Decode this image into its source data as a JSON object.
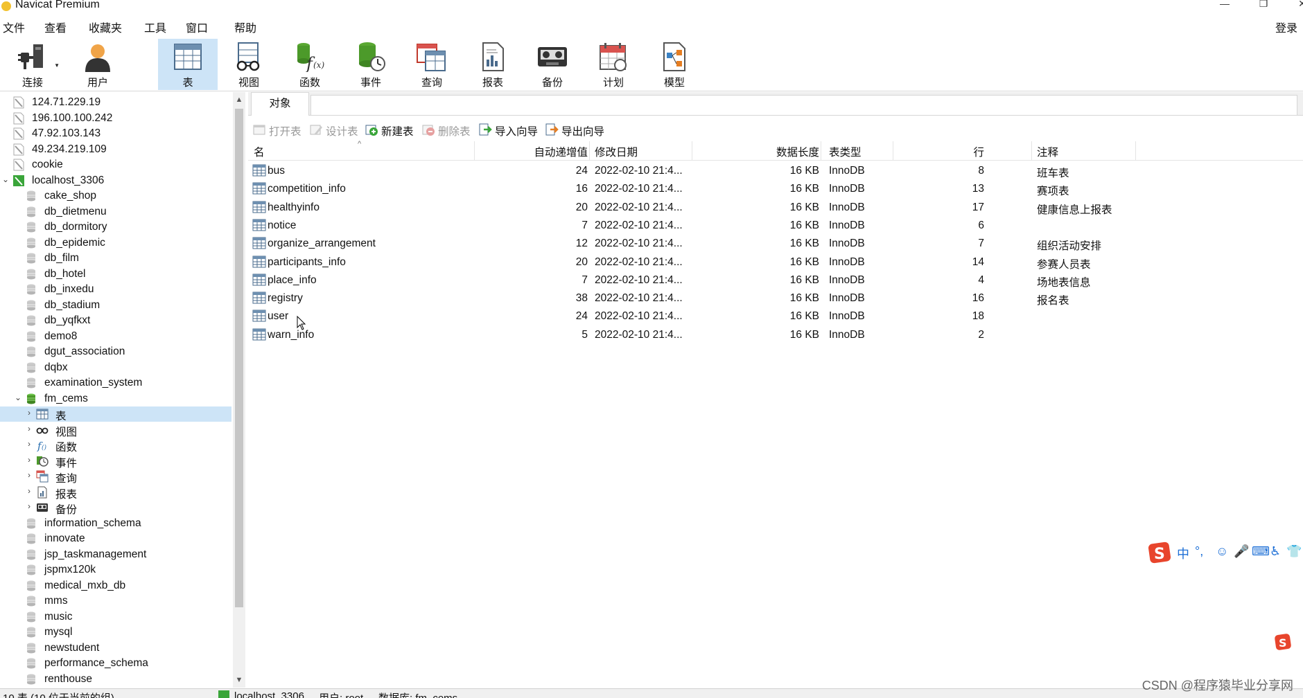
{
  "window": {
    "title": "Navicat Premium",
    "minimize": "—",
    "restore": "❐",
    "close": "✕"
  },
  "menu": [
    "文件",
    "查看",
    "收藏夹",
    "工具",
    "窗口",
    "帮助"
  ],
  "login_label": "登录",
  "toolbar": [
    {
      "label": "连接",
      "icon": "connection-plug-icon"
    },
    {
      "label": "用户",
      "icon": "user-icon"
    },
    {
      "label": "表",
      "icon": "table-icon",
      "active": true
    },
    {
      "label": "视图",
      "icon": "view-glasses-icon"
    },
    {
      "label": "函数",
      "icon": "function-icon"
    },
    {
      "label": "事件",
      "icon": "event-clock-icon"
    },
    {
      "label": "查询",
      "icon": "query-icon"
    },
    {
      "label": "报表",
      "icon": "report-icon"
    },
    {
      "label": "备份",
      "icon": "backup-icon"
    },
    {
      "label": "计划",
      "icon": "schedule-calendar-icon"
    },
    {
      "label": "模型",
      "icon": "model-icon"
    }
  ],
  "tree": [
    {
      "label": "124.71.229.19",
      "type": "server"
    },
    {
      "label": "196.100.100.242",
      "type": "server"
    },
    {
      "label": "47.92.103.143",
      "type": "server"
    },
    {
      "label": "49.234.219.109",
      "type": "server"
    },
    {
      "label": "cookie",
      "type": "server"
    },
    {
      "label": "localhost_3306",
      "type": "server-open",
      "expander": "⌄"
    },
    {
      "label": "cake_shop",
      "type": "db"
    },
    {
      "label": "db_dietmenu",
      "type": "db"
    },
    {
      "label": "db_dormitory",
      "type": "db"
    },
    {
      "label": "db_epidemic",
      "type": "db"
    },
    {
      "label": "db_film",
      "type": "db"
    },
    {
      "label": "db_hotel",
      "type": "db"
    },
    {
      "label": "db_inxedu",
      "type": "db"
    },
    {
      "label": "db_stadium",
      "type": "db"
    },
    {
      "label": "db_yqfkxt",
      "type": "db"
    },
    {
      "label": "demo8",
      "type": "db"
    },
    {
      "label": "dgut_association",
      "type": "db"
    },
    {
      "label": "dqbx",
      "type": "db"
    },
    {
      "label": "examination_system",
      "type": "db"
    },
    {
      "label": "fm_cems",
      "type": "db-open",
      "expander": "⌄"
    },
    {
      "label": "表",
      "type": "node-table",
      "expander": "›",
      "selected": true
    },
    {
      "label": "视图",
      "type": "node-view",
      "expander": "›"
    },
    {
      "label": "函数",
      "type": "node-func",
      "expander": "›"
    },
    {
      "label": "事件",
      "type": "node-event",
      "expander": "›"
    },
    {
      "label": "查询",
      "type": "node-query",
      "expander": "›"
    },
    {
      "label": "报表",
      "type": "node-report",
      "expander": "›"
    },
    {
      "label": "备份",
      "type": "node-backup",
      "expander": "›"
    },
    {
      "label": "information_schema",
      "type": "db"
    },
    {
      "label": "innovate",
      "type": "db"
    },
    {
      "label": "jsp_taskmanagement",
      "type": "db"
    },
    {
      "label": "jspmx120k",
      "type": "db"
    },
    {
      "label": "medical_mxb_db",
      "type": "db"
    },
    {
      "label": "mms",
      "type": "db"
    },
    {
      "label": "music",
      "type": "db"
    },
    {
      "label": "mysql",
      "type": "db"
    },
    {
      "label": "newstudent",
      "type": "db"
    },
    {
      "label": "performance_schema",
      "type": "db"
    },
    {
      "label": "renthouse",
      "type": "db"
    }
  ],
  "tab_label": "对象",
  "object_toolbar": [
    {
      "label": "打开表",
      "enabled": false,
      "icon": "open-table-icon"
    },
    {
      "label": "设计表",
      "enabled": false,
      "icon": "design-table-icon"
    },
    {
      "label": "新建表",
      "enabled": true,
      "icon": "new-table-icon"
    },
    {
      "label": "删除表",
      "enabled": false,
      "icon": "delete-table-icon"
    },
    {
      "label": "导入向导",
      "enabled": true,
      "icon": "import-wizard-icon"
    },
    {
      "label": "导出向导",
      "enabled": true,
      "icon": "export-wizard-icon"
    }
  ],
  "columns": {
    "name": "名",
    "auto_inc": "自动递增值",
    "modified": "修改日期",
    "data_length": "数据长度",
    "engine": "表类型",
    "rows": "行",
    "comment": "注释"
  },
  "tables": [
    {
      "name": "bus",
      "auto_inc": "24",
      "modified": "2022-02-10 21:4...",
      "data_length": "16 KB",
      "engine": "InnoDB",
      "rows": "8",
      "comment": "班车表"
    },
    {
      "name": "competition_info",
      "auto_inc": "16",
      "modified": "2022-02-10 21:4...",
      "data_length": "16 KB",
      "engine": "InnoDB",
      "rows": "13",
      "comment": "赛项表"
    },
    {
      "name": "healthyinfo",
      "auto_inc": "20",
      "modified": "2022-02-10 21:4...",
      "data_length": "16 KB",
      "engine": "InnoDB",
      "rows": "17",
      "comment": "健康信息上报表"
    },
    {
      "name": "notice",
      "auto_inc": "7",
      "modified": "2022-02-10 21:4...",
      "data_length": "16 KB",
      "engine": "InnoDB",
      "rows": "6",
      "comment": ""
    },
    {
      "name": "organize_arrangement",
      "auto_inc": "12",
      "modified": "2022-02-10 21:4...",
      "data_length": "16 KB",
      "engine": "InnoDB",
      "rows": "7",
      "comment": "组织活动安排"
    },
    {
      "name": "participants_info",
      "auto_inc": "20",
      "modified": "2022-02-10 21:4...",
      "data_length": "16 KB",
      "engine": "InnoDB",
      "rows": "14",
      "comment": "参赛人员表"
    },
    {
      "name": "place_info",
      "auto_inc": "7",
      "modified": "2022-02-10 21:4...",
      "data_length": "16 KB",
      "engine": "InnoDB",
      "rows": "4",
      "comment": "场地表信息"
    },
    {
      "name": "registry",
      "auto_inc": "38",
      "modified": "2022-02-10 21:4...",
      "data_length": "16 KB",
      "engine": "InnoDB",
      "rows": "16",
      "comment": "报名表"
    },
    {
      "name": "user",
      "auto_inc": "24",
      "modified": "2022-02-10 21:4...",
      "data_length": "16 KB",
      "engine": "InnoDB",
      "rows": "18",
      "comment": ""
    },
    {
      "name": "warn_info",
      "auto_inc": "5",
      "modified": "2022-02-10 21:4...",
      "data_length": "16 KB",
      "engine": "InnoDB",
      "rows": "2",
      "comment": ""
    }
  ],
  "ime": {
    "lang": "中",
    "punct": "°,",
    "items": [
      "☺",
      "🎤",
      "⌨",
      "♿",
      "👕"
    ]
  },
  "status": {
    "left": "10 表 (10 位于当前的组)",
    "connection": "localhost_3306",
    "user": "用户: root",
    "database": "数据库: fm_cems"
  },
  "watermark": "CSDN @程序猿毕业分享网"
}
